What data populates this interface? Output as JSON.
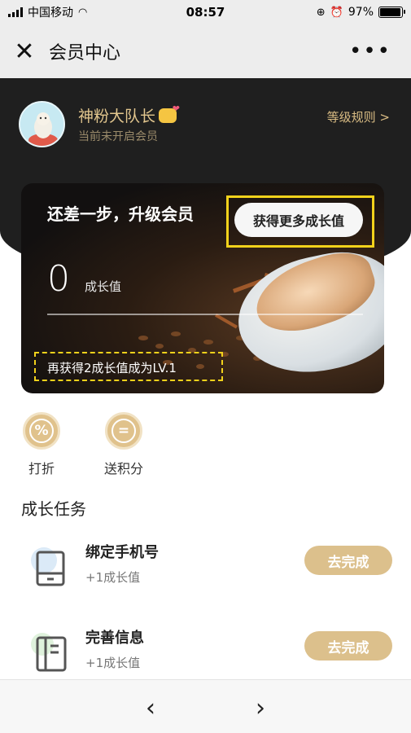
{
  "status": {
    "carrier": "中国移动",
    "time": "08:57",
    "battery": "97%",
    "battery_level": 0.97
  },
  "nav": {
    "title": "会员中心",
    "more": "•••"
  },
  "user": {
    "name": "神粉大队长",
    "status": "当前未开启会员",
    "rules_link": "等级规则 >"
  },
  "card": {
    "title": "还差一步，升级会员",
    "cta": "获得更多成长值",
    "points": "0",
    "points_label": "成长值",
    "progress": 0,
    "next_level": "再获得2成长值成为LV.1"
  },
  "benefits": [
    {
      "label": "打折",
      "icon": "percent-icon",
      "symbol": "%"
    },
    {
      "label": "送积分",
      "icon": "points-icon",
      "symbol": "="
    }
  ],
  "tasks_section": {
    "title": "成长任务"
  },
  "tasks": [
    {
      "name": "绑定手机号",
      "reward": "+1成长值",
      "button": "去完成",
      "icon": "phone-icon"
    },
    {
      "name": "完善信息",
      "reward": "+1成长值",
      "button": "去完成",
      "icon": "info-book-icon"
    }
  ],
  "bottom_nav": {
    "back": "‹",
    "forward": "›"
  },
  "colors": {
    "gold": "#dcc08c",
    "dark": "#1f1f1f",
    "highlight": "#f2d21b"
  }
}
